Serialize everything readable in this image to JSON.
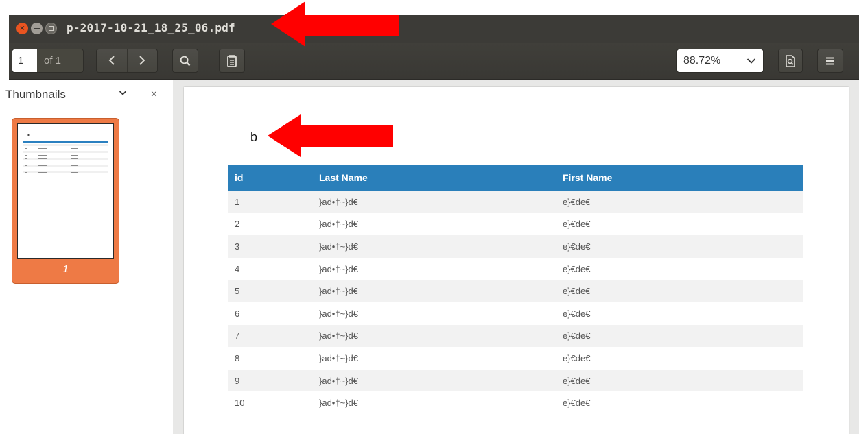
{
  "window": {
    "title": "p-2017-10-21_18_25_06.pdf",
    "controls": {
      "close": "×",
      "minimize": "–",
      "maximize": "□"
    }
  },
  "toolbar": {
    "page_number": "1",
    "page_count_label": "of 1",
    "prev_icon": "‹",
    "next_icon": "›",
    "zoom_value": "88.72%",
    "zoom_chevron": "⌄"
  },
  "sidebar": {
    "title": "Thumbnails",
    "chevron": "⌄",
    "close": "×",
    "thumbnails": [
      {
        "page_label": "1"
      }
    ]
  },
  "document": {
    "heading": "b",
    "table": {
      "columns": [
        "id",
        "Last Name",
        "First Name"
      ],
      "rows": [
        [
          "1",
          "}ad•†~}d€",
          "e}€de€"
        ],
        [
          "2",
          "}ad•†~}d€",
          "e}€de€"
        ],
        [
          "3",
          "}ad•†~}d€",
          "e}€de€"
        ],
        [
          "4",
          "}ad•†~}d€",
          "e}€de€"
        ],
        [
          "5",
          "}ad•†~}d€",
          "e}€de€"
        ],
        [
          "6",
          "}ad•†~}d€",
          "e}€de€"
        ],
        [
          "7",
          "}ad•†~}d€",
          "e}€de€"
        ],
        [
          "8",
          "}ad•†~}d€",
          "e}€de€"
        ],
        [
          "9",
          "}ad•†~}d€",
          "e}€de€"
        ],
        [
          "10",
          "}ad•†~}d€",
          "e}€de€"
        ]
      ]
    }
  },
  "colors": {
    "accent_orange": "#ee7a45",
    "table_header": "#2a7fba",
    "annotation_arrow": "#ff0000",
    "titlebar": "#3c3b37"
  }
}
